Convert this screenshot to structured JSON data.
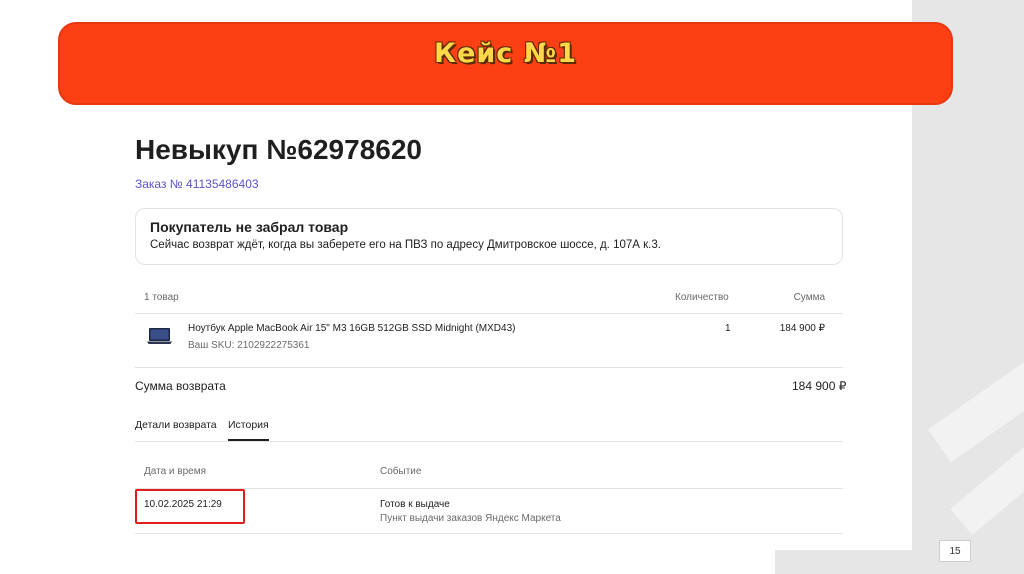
{
  "slide": {
    "banner_title": "Кейс №1",
    "page_number": "15"
  },
  "page": {
    "title": "Невыкуп №62978620",
    "order_link": "Заказ № 41135486403"
  },
  "status": {
    "title": "Покупатель не забрал товар",
    "text": "Сейчас возврат ждёт, когда вы заберете его на ПВЗ по адресу Дмитровское шоссе, д. 107А к.3."
  },
  "items": {
    "header": {
      "count": "1 товар",
      "qty": "Количество",
      "sum": "Сумма"
    },
    "rows": [
      {
        "name": "Ноутбук Apple MacBook Air 15\" M3 16GB 512GB SSD Midnight (MXD43)",
        "sku": "Ваш SKU: 2102922275361",
        "qty": "1",
        "price": "184 900 ₽",
        "icon": "laptop-icon"
      }
    ]
  },
  "refund": {
    "label": "Сумма возврата",
    "value": "184 900 ₽"
  },
  "tabs": [
    {
      "label": "Детали возврата",
      "active": false
    },
    {
      "label": "История",
      "active": true
    }
  ],
  "history": {
    "header": {
      "date": "Дата и время",
      "event": "Событие"
    },
    "rows": [
      {
        "date": "10.02.2025 21:29",
        "event": "Готов к выдаче",
        "place": "Пункт выдачи заказов Яндекс Маркета"
      }
    ]
  },
  "colors": {
    "banner": "#fd3f14",
    "banner_text": "#ffd84a",
    "link": "#5a54c8",
    "highlight": "#e31d1d"
  }
}
